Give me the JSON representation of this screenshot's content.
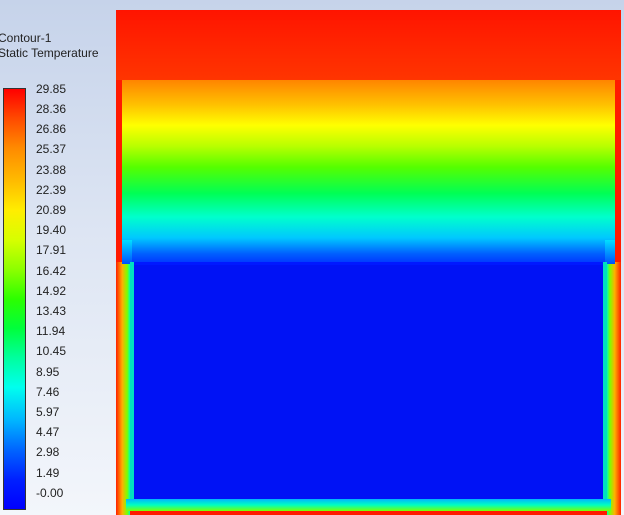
{
  "legend": {
    "title_line1": "Contour-1",
    "title_line2": "Static Temperature",
    "colormap_colors": [
      "#ff0000",
      "#ffee00",
      "#2cff00",
      "#00ffee",
      "#0000ff"
    ],
    "ticks": [
      "29.85",
      "28.36",
      "26.86",
      "25.37",
      "23.88",
      "22.39",
      "20.89",
      "19.40",
      "17.91",
      "16.42",
      "14.92",
      "13.43",
      "11.94",
      "10.45",
      "8.95",
      "7.46",
      "5.97",
      "4.47",
      "2.98",
      "1.49",
      "-0.00"
    ]
  }
}
